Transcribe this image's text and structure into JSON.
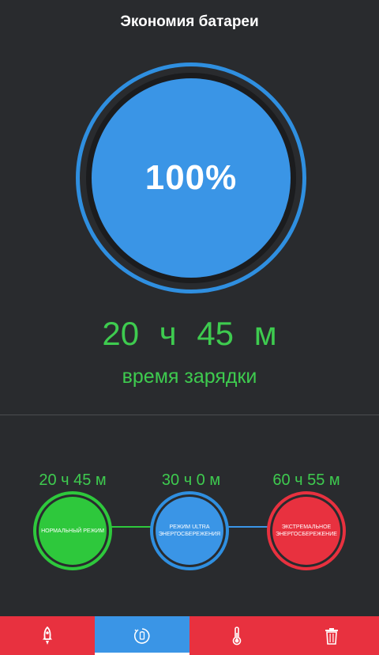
{
  "header": {
    "title": "Экономия батареи"
  },
  "gauge": {
    "percent": "100%",
    "level": 1.0
  },
  "remaining": {
    "time": "20 ч  45 м",
    "caption": "время зарядки"
  },
  "modes": [
    {
      "time": "20 ч 45 м",
      "label": "Нормальный режим",
      "color": "#2ec83c"
    },
    {
      "time": "30 ч  0 м",
      "label": "Режим ULTRA энергосбережения",
      "color": "#3a95e6"
    },
    {
      "time": "60 ч 55 м",
      "label": "Экстремальное энергосбережение",
      "color": "#e8313f"
    }
  ],
  "tabs": [
    {
      "icon": "rocket-icon",
      "active": false
    },
    {
      "icon": "battery-saver-icon",
      "active": true
    },
    {
      "icon": "thermometer-icon",
      "active": false
    },
    {
      "icon": "trash-icon",
      "active": false
    }
  ],
  "colors": {
    "accent_blue": "#3a95e6",
    "green": "#3ecb4f",
    "red": "#e8313f",
    "background": "#292b2e"
  }
}
